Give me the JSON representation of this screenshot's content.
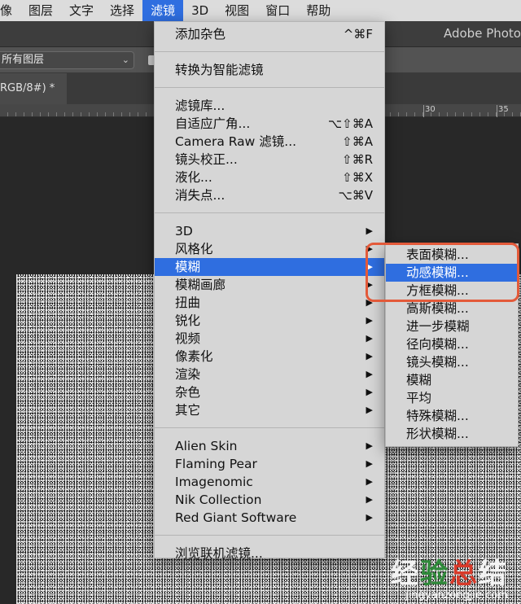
{
  "menubar": {
    "items": [
      "像",
      "图层",
      "文字",
      "选择",
      "滤镜",
      "3D",
      "视图",
      "窗口",
      "帮助"
    ],
    "active_index": 4
  },
  "titlebar": {
    "app_name": "Adobe Photo"
  },
  "options_bar": {
    "layer_select_value": "所有图层"
  },
  "document_tab": {
    "label": "RGB/8#) *"
  },
  "ruler": {
    "ticks": [
      "30",
      "35"
    ]
  },
  "filter_menu": {
    "items": [
      {
        "type": "item",
        "label": "添加杂色",
        "shortcut": "^⌘F"
      },
      {
        "type": "sep"
      },
      {
        "type": "item",
        "label": "转换为智能滤镜"
      },
      {
        "type": "sep"
      },
      {
        "type": "item",
        "label": "滤镜库..."
      },
      {
        "type": "item",
        "label": "自适应广角...",
        "shortcut": "⌥⇧⌘A"
      },
      {
        "type": "item",
        "label": "Camera Raw 滤镜...",
        "shortcut": "⇧⌘A"
      },
      {
        "type": "item",
        "label": "镜头校正...",
        "shortcut": "⇧⌘R"
      },
      {
        "type": "item",
        "label": "液化...",
        "shortcut": "⇧⌘X"
      },
      {
        "type": "item",
        "label": "消失点...",
        "shortcut": "⌥⌘V"
      },
      {
        "type": "sep"
      },
      {
        "type": "item",
        "label": "3D",
        "submenu": true
      },
      {
        "type": "item",
        "label": "风格化",
        "submenu": true
      },
      {
        "type": "item",
        "label": "模糊",
        "submenu": true,
        "selected": true
      },
      {
        "type": "item",
        "label": "模糊画廊",
        "submenu": true
      },
      {
        "type": "item",
        "label": "扭曲",
        "submenu": true
      },
      {
        "type": "item",
        "label": "锐化",
        "submenu": true
      },
      {
        "type": "item",
        "label": "视频",
        "submenu": true
      },
      {
        "type": "item",
        "label": "像素化",
        "submenu": true
      },
      {
        "type": "item",
        "label": "渲染",
        "submenu": true
      },
      {
        "type": "item",
        "label": "杂色",
        "submenu": true
      },
      {
        "type": "item",
        "label": "其它",
        "submenu": true
      },
      {
        "type": "sep"
      },
      {
        "type": "item",
        "label": "Alien Skin",
        "submenu": true
      },
      {
        "type": "item",
        "label": "Flaming Pear",
        "submenu": true
      },
      {
        "type": "item",
        "label": "Imagenomic",
        "submenu": true
      },
      {
        "type": "item",
        "label": "Nik Collection",
        "submenu": true
      },
      {
        "type": "item",
        "label": "Red Giant Software",
        "submenu": true
      },
      {
        "type": "sep"
      },
      {
        "type": "item",
        "label": "浏览联机滤镜..."
      }
    ]
  },
  "blur_submenu": {
    "items": [
      {
        "label": "表面模糊..."
      },
      {
        "label": "动感模糊...",
        "selected": true
      },
      {
        "label": "方框模糊..."
      },
      {
        "label": "高斯模糊..."
      },
      {
        "label": "进一步模糊"
      },
      {
        "label": "径向模糊..."
      },
      {
        "label": "镜头模糊..."
      },
      {
        "label": "模糊"
      },
      {
        "label": "平均"
      },
      {
        "label": "特殊模糊..."
      },
      {
        "label": "形状模糊..."
      }
    ]
  },
  "icons": {
    "submenu_arrow": "▶",
    "dropdown_chevron": "⌄"
  },
  "highlight_color": "#e35a3a",
  "selection_color": "#2f6ee0",
  "watermark": {
    "chars": [
      "经",
      "验",
      "总",
      "结"
    ],
    "url": "jingyanzongjie.com"
  }
}
